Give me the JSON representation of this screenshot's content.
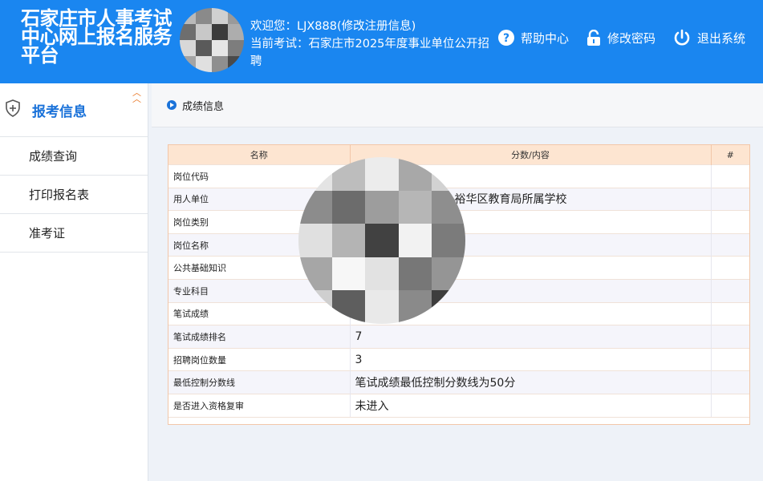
{
  "header": {
    "site_title": "石家庄市人事考试中心网上报名服务平台",
    "welcome_line": "欢迎您：LJX888(修改注册信息)",
    "current_exam_line": "当前考试：石家庄市2025年度事业单位公开招聘",
    "actions": [
      {
        "label": "帮助中心",
        "icon": "help-icon"
      },
      {
        "label": "修改密码",
        "icon": "lock-icon"
      },
      {
        "label": "退出系统",
        "icon": "power-icon"
      }
    ]
  },
  "sidebar": {
    "section_title": "报考信息",
    "items": [
      {
        "label": "成绩查询"
      },
      {
        "label": "打印报名表"
      },
      {
        "label": "准考证"
      }
    ]
  },
  "main": {
    "section_title": "成绩信息",
    "table": {
      "headers": [
        "名称",
        "分数/内容",
        "#"
      ],
      "rows": [
        {
          "name": "岗位代码",
          "value": ""
        },
        {
          "name": "用人单位",
          "value": "裕华区教育局所属学校"
        },
        {
          "name": "岗位类别",
          "value": ""
        },
        {
          "name": "岗位名称",
          "value": ""
        },
        {
          "name": "公共基础知识",
          "value": ""
        },
        {
          "name": "专业科目",
          "value": ""
        },
        {
          "name": "笔试成绩",
          "value": ""
        },
        {
          "name": "笔试成绩排名",
          "value": "7"
        },
        {
          "name": "招聘岗位数量",
          "value": "3"
        },
        {
          "name": "最低控制分数线",
          "value": "笔试成绩最低控制分数线为50分"
        },
        {
          "name": "是否进入资格复审",
          "value": "未进入"
        }
      ]
    }
  },
  "colors": {
    "header_bg": "#1a86f0",
    "accent": "#1a72d9",
    "table_header_bg": "#fde5d1"
  }
}
